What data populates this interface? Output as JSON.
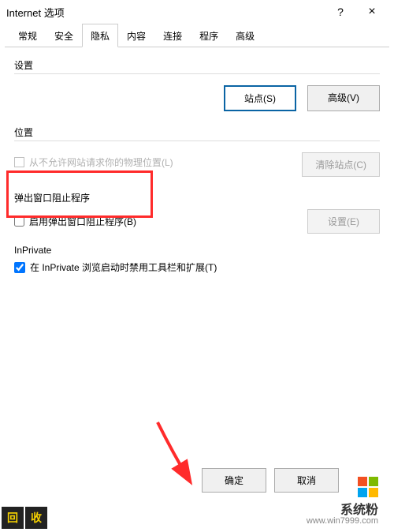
{
  "titlebar": {
    "title": "Internet 选项",
    "help": "?",
    "close": "×"
  },
  "tabs": {
    "items": [
      "常规",
      "安全",
      "隐私",
      "内容",
      "连接",
      "程序",
      "高级"
    ],
    "activeIndex": 2
  },
  "sections": {
    "settings": {
      "title": "设置",
      "sites_btn": "站点(S)",
      "advanced_btn": "高级(V)"
    },
    "location": {
      "title": "位置",
      "never_allow_label": "从不允许网站请求你的物理位置(L)",
      "clear_btn": "清除站点(C)"
    },
    "popup": {
      "title": "弹出窗口阻止程序",
      "enable_label": "启用弹出窗口阻止程序(B)",
      "settings_btn": "设置(E)"
    },
    "inprivate": {
      "title": "InPrivate",
      "disable_toolbars_label": "在 InPrivate 浏览启动时禁用工具栏和扩展(T)"
    }
  },
  "footer": {
    "ok": "确定",
    "cancel": "取消"
  },
  "watermark": {
    "line1": "系统粉",
    "line2": "www.win7999.com"
  },
  "bottomstrip": {
    "a": "回",
    "b": "收"
  }
}
